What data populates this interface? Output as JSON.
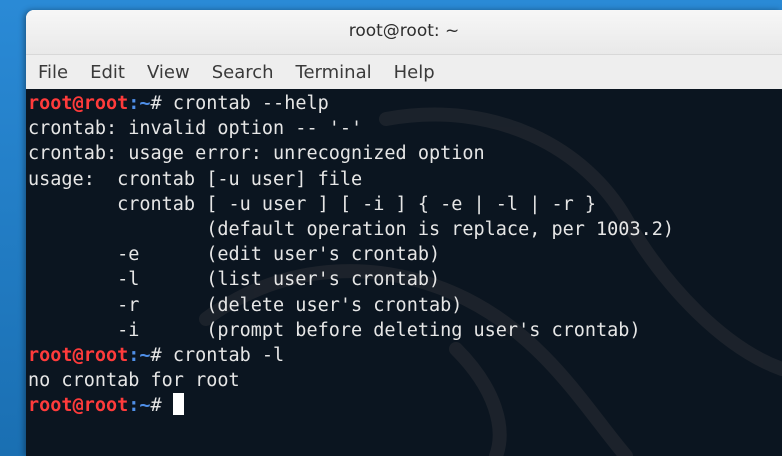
{
  "window": {
    "title": "root@root: ~"
  },
  "menu": [
    "File",
    "Edit",
    "View",
    "Search",
    "Terminal",
    "Help"
  ],
  "prompt": {
    "user_host": "root@root",
    "path": ":~",
    "symbol": "# "
  },
  "terminal": {
    "lines": [
      {
        "type": "prompt",
        "command": "crontab --help"
      },
      {
        "type": "output",
        "text": "crontab: invalid option -- '-'"
      },
      {
        "type": "output",
        "text": "crontab: usage error: unrecognized option"
      },
      {
        "type": "output",
        "text": "usage:  crontab [-u user] file"
      },
      {
        "type": "output",
        "text": "        crontab [ -u user ] [ -i ] { -e | -l | -r }"
      },
      {
        "type": "output",
        "text": "                (default operation is replace, per 1003.2)"
      },
      {
        "type": "output",
        "text": "        -e      (edit user's crontab)"
      },
      {
        "type": "output",
        "text": "        -l      (list user's crontab)"
      },
      {
        "type": "output",
        "text": "        -r      (delete user's crontab)"
      },
      {
        "type": "output",
        "text": "        -i      (prompt before deleting user's crontab)"
      },
      {
        "type": "prompt",
        "command": "crontab -l"
      },
      {
        "type": "output",
        "text": "no crontab for root"
      },
      {
        "type": "prompt",
        "command": "",
        "cursor": true
      }
    ]
  },
  "colors": {
    "terminal_bg": "#0b1520",
    "prompt_user": "#ff3b3b",
    "prompt_path": "#4f8fe8",
    "text": "#e6e6e6"
  },
  "icons": {
    "background": "kali-dragon-watermark"
  }
}
